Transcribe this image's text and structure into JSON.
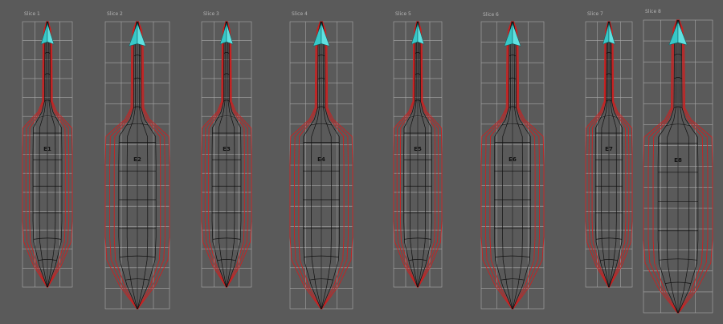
{
  "viewport": {
    "background_color": "#5a5a5a",
    "grid_color": "#a8a8a8",
    "outline_color": "#cc2020",
    "mesh_color": "#101010",
    "tip_color": "#37c7c7"
  },
  "slices": [
    {
      "title": "Slice 1",
      "label": "E1"
    },
    {
      "title": "Slice 2",
      "label": "E2"
    },
    {
      "title": "Slice 3",
      "label": "E3"
    },
    {
      "title": "Slice 4",
      "label": "E4"
    },
    {
      "title": "Slice 5",
      "label": "E5"
    },
    {
      "title": "Slice 6",
      "label": "E6"
    },
    {
      "title": "Slice 7",
      "label": "E7"
    },
    {
      "title": "Slice 8",
      "label": "E8"
    }
  ]
}
